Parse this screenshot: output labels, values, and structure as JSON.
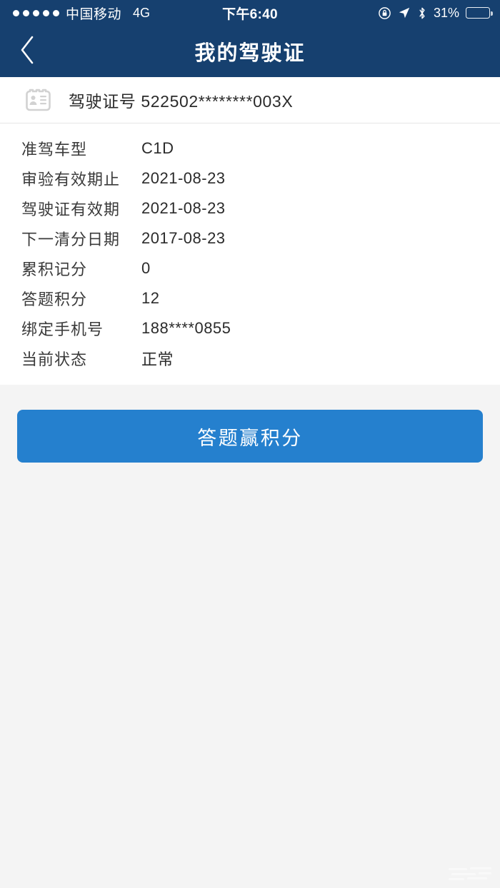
{
  "statusbar": {
    "signal_dots": 5,
    "carrier": "中国移动",
    "network": "4G",
    "time": "下午6:40",
    "battery_percent": "31%",
    "battery_level": 31,
    "icons": [
      "rotation-lock-icon",
      "location-arrow-icon",
      "bluetooth-icon",
      "battery-icon"
    ]
  },
  "navbar": {
    "back_icon": "chevron-left-icon",
    "title": "我的驾驶证"
  },
  "license": {
    "icon": "id-card-icon",
    "label": "驾驶证号",
    "number": "522502********003X",
    "full_text": "驾驶证号 522502********003X"
  },
  "details": [
    {
      "label": "准驾车型",
      "value": "C1D"
    },
    {
      "label": "审验有效期止",
      "value": "2021-08-23"
    },
    {
      "label": "驾驶证有效期",
      "value": "2021-08-23"
    },
    {
      "label": "下一清分日期",
      "value": "2017-08-23"
    },
    {
      "label": "累积记分",
      "value": "0"
    },
    {
      "label": "答题积分",
      "value": "12"
    },
    {
      "label": "绑定手机号",
      "value": "188****0855"
    },
    {
      "label": "当前状态",
      "value": "正常"
    }
  ],
  "action": {
    "label": "答题赢积分"
  },
  "colors": {
    "navbar_blue": "#16406f",
    "button_blue": "#2580ce",
    "page_background": "#f4f4f4",
    "card_background": "#ffffff",
    "label_text": "#3a3a3a",
    "value_text": "#2b2b2b",
    "icon_gray": "#d2d2d2"
  }
}
